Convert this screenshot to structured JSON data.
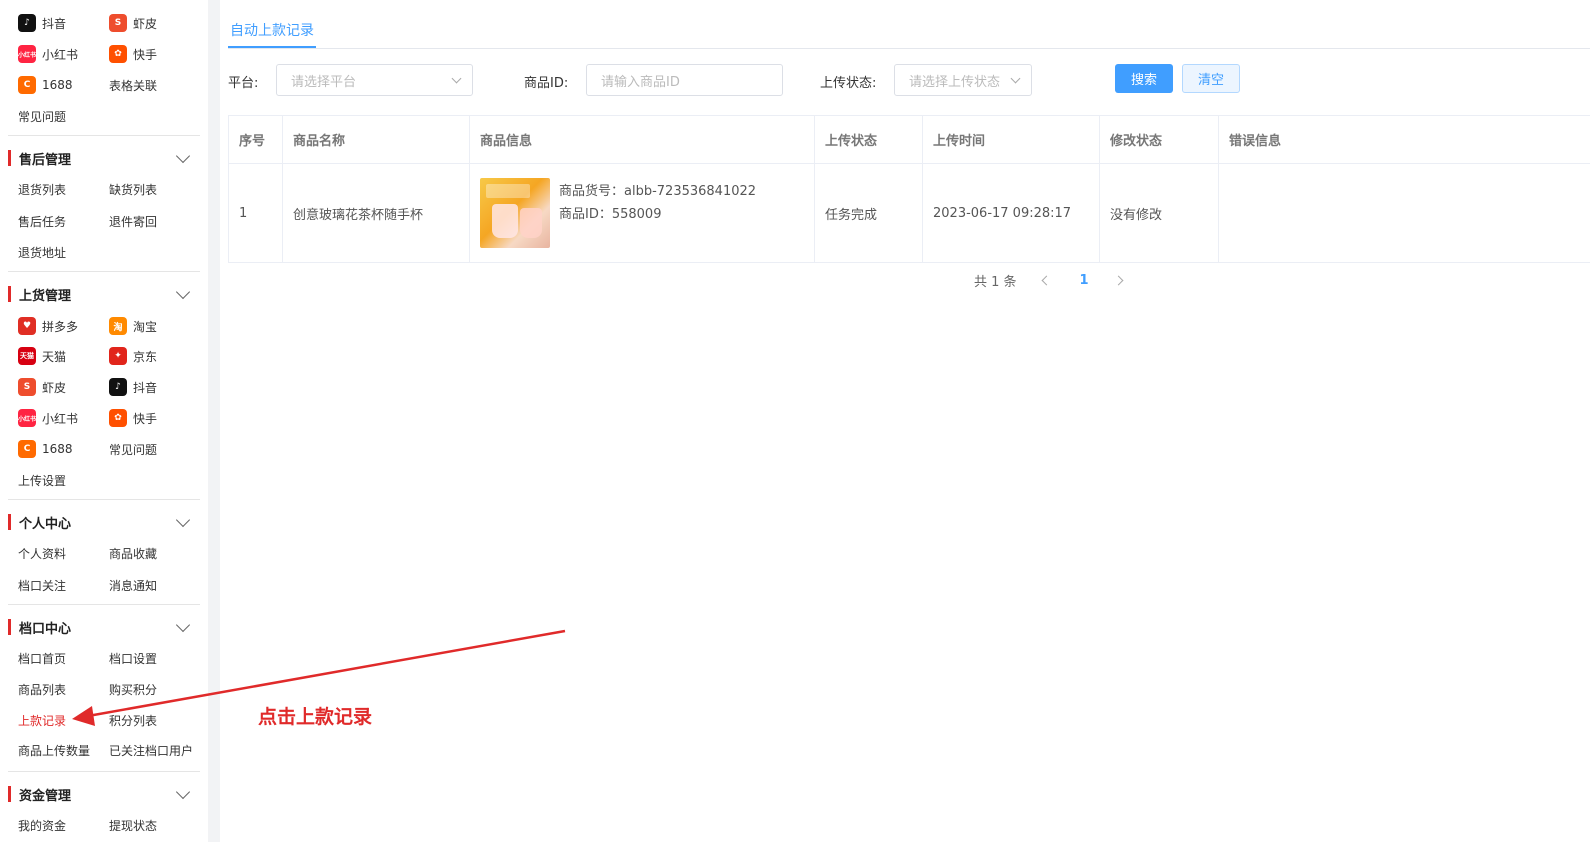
{
  "sidebar": {
    "top_items": [
      {
        "label": "抖音",
        "icon": "douyin-icon",
        "color": "#111111"
      },
      {
        "label": "虾皮",
        "icon": "shopee-icon",
        "color": "#ee4d2d"
      },
      {
        "label": "小红书",
        "icon": "xiaohongshu-icon",
        "color": "#ff2442"
      },
      {
        "label": "快手",
        "icon": "kuaishou-icon",
        "color": "#ff5000"
      },
      {
        "label": "1688",
        "icon": "1688-icon",
        "color": "#ff6a00"
      },
      {
        "label": "表格关联"
      },
      {
        "label": "常见问题"
      }
    ],
    "after_sales": {
      "title": "售后管理",
      "items": [
        "退货列表",
        "缺货列表",
        "售后任务",
        "退件寄回",
        "退货地址"
      ]
    },
    "listing": {
      "title": "上货管理",
      "items": [
        {
          "label": "拼多多",
          "icon": "pinduoduo-icon",
          "color": "#e02e24"
        },
        {
          "label": "淘宝",
          "icon": "taobao-icon",
          "color": "#ff5000"
        },
        {
          "label": "天猫",
          "icon": "tmall-icon",
          "color": "#d70011"
        },
        {
          "label": "京东",
          "icon": "jd-icon",
          "color": "#e1251b"
        },
        {
          "label": "虾皮",
          "icon": "shopee-icon",
          "color": "#ee4d2d"
        },
        {
          "label": "抖音",
          "icon": "douyin-icon",
          "color": "#111111"
        },
        {
          "label": "小红书",
          "icon": "xiaohongshu-icon",
          "color": "#ff2442"
        },
        {
          "label": "快手",
          "icon": "kuaishou-icon",
          "color": "#ff5000"
        },
        {
          "label": "1688",
          "icon": "1688-icon",
          "color": "#ff6a00"
        },
        {
          "label": "常见问题"
        },
        {
          "label": "上传设置"
        }
      ]
    },
    "personal": {
      "title": "个人中心",
      "items": [
        "个人资料",
        "商品收藏",
        "档口关注",
        "消息通知"
      ]
    },
    "stall": {
      "title": "档口中心",
      "items": [
        "档口首页",
        "档口设置",
        "商品列表",
        "购买积分",
        "上款记录",
        "积分列表",
        "商品上传数量",
        "已关注档口用户"
      ]
    },
    "funds": {
      "title": "资金管理",
      "items": [
        "我的资金",
        "提现状态"
      ]
    }
  },
  "tab": {
    "label": "自动上款记录"
  },
  "filters": {
    "platform_label": "平台:",
    "platform_placeholder": "请选择平台",
    "product_id_label": "商品ID:",
    "product_id_placeholder": "请输入商品ID",
    "status_label": "上传状态:",
    "status_placeholder": "请选择上传状态",
    "search_label": "搜索",
    "clear_label": "清空"
  },
  "table": {
    "headers": [
      "序号",
      "商品名称",
      "商品信息",
      "上传状态",
      "上传时间",
      "修改状态",
      "错误信息"
    ],
    "rows": [
      {
        "index": "1",
        "name": "创意玻璃花茶杯随手杯",
        "sku": "商品货号：albb-723536841022",
        "product_id": "商品ID：558009",
        "status": "任务完成",
        "time": "2023-06-17 09:28:17",
        "modify": "没有修改",
        "error": ""
      }
    ]
  },
  "pagination": {
    "total": "共 1 条",
    "current": "1"
  },
  "annotation": {
    "text": "点击上款记录",
    "color": "#e02a2a"
  },
  "colors": {
    "accent": "#409eff",
    "brand_red": "#e02a2a"
  }
}
